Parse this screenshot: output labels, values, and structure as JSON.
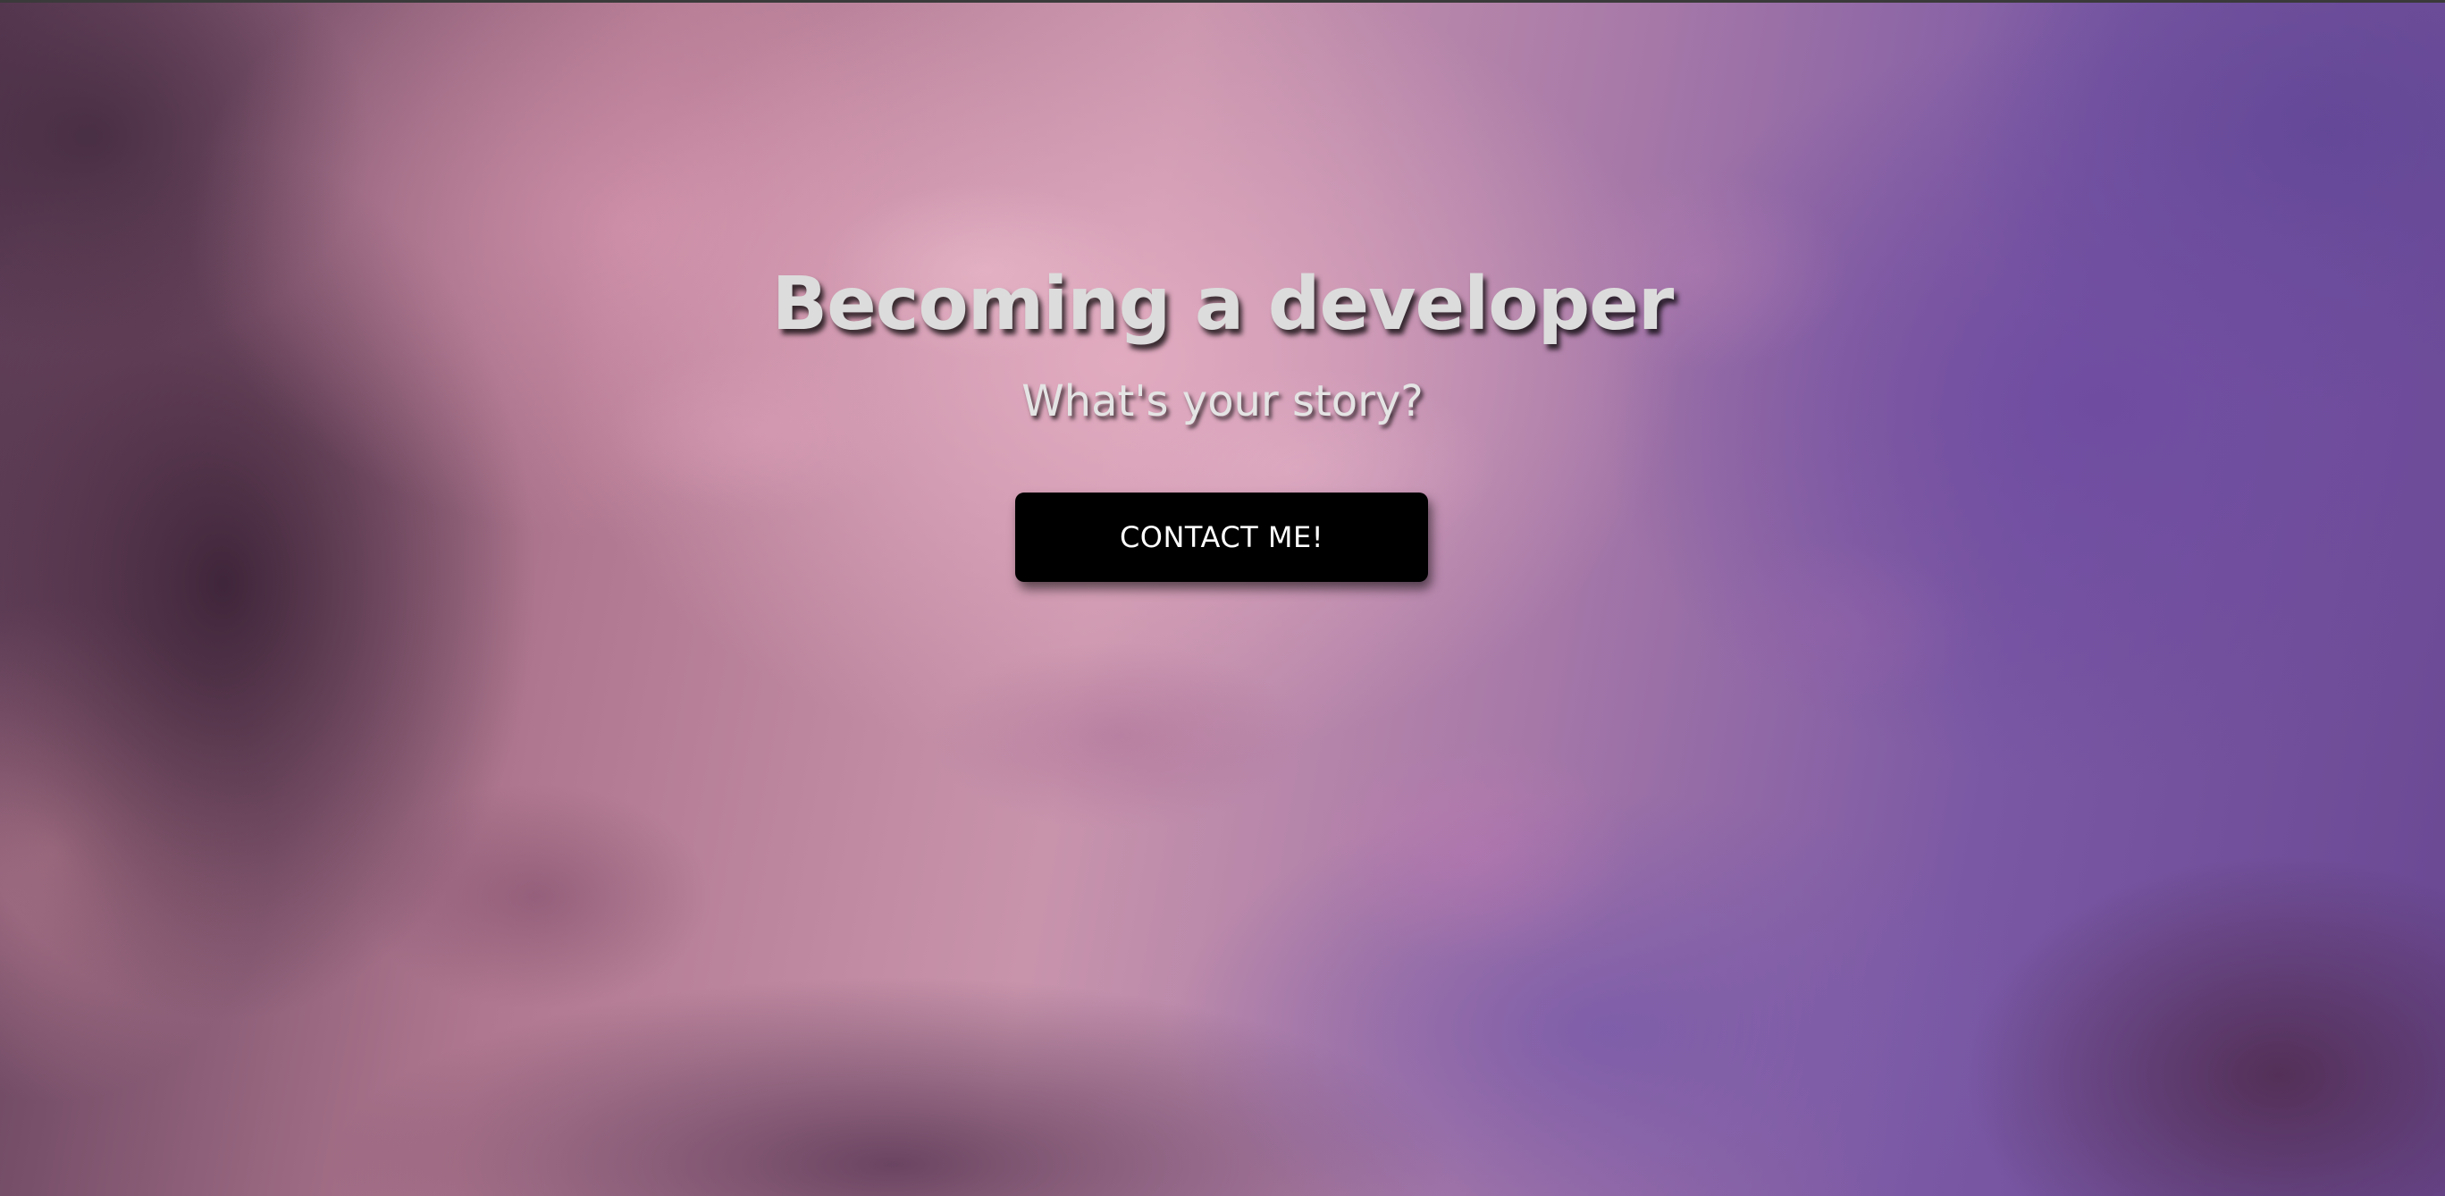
{
  "hero": {
    "title": "Becoming a developer",
    "subtitle": "What's your story?",
    "cta_label": "CONTACT ME!"
  },
  "colors": {
    "title_text": "#dcdcdc",
    "button_background": "#000000",
    "button_text": "#ffffff",
    "background_pink": "#c894ac",
    "background_purple": "#6a4892"
  }
}
